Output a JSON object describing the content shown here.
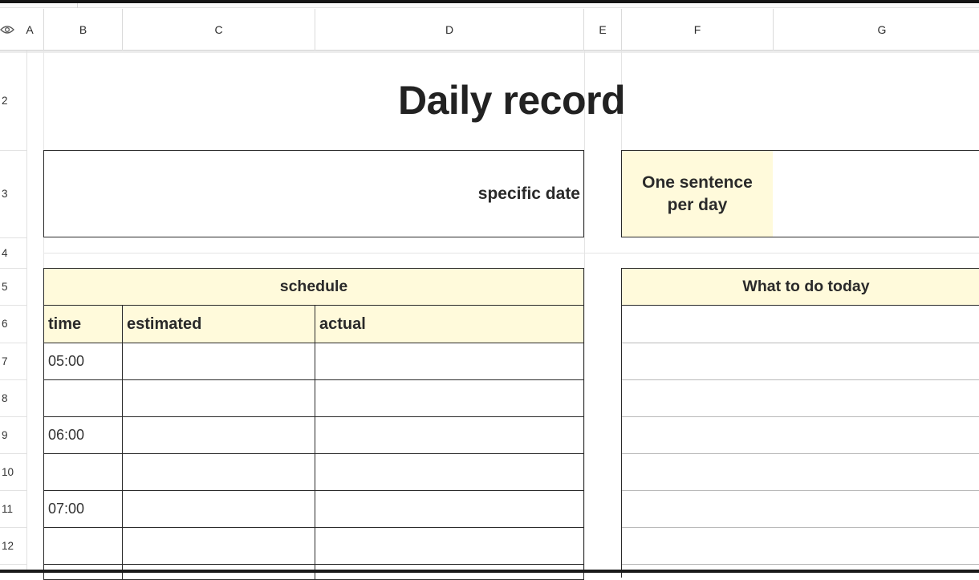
{
  "columns": [
    "A",
    "B",
    "C",
    "D",
    "E",
    "F",
    "G"
  ],
  "rows": [
    "2",
    "3",
    "4",
    "5",
    "6",
    "7",
    "8",
    "9",
    "10",
    "11",
    "12"
  ],
  "title": "Daily record",
  "date_label": "specific date",
  "sentence_label_line1": "One sentence",
  "sentence_label_line2": "per day",
  "schedule": {
    "header": "schedule",
    "col_time": "time",
    "col_estimated": "estimated",
    "col_actual": "actual",
    "times": [
      "05:00",
      "",
      "06:00",
      "",
      "07:00",
      ""
    ]
  },
  "todo_header": "What to do today",
  "colors": {
    "header_fill": "#fffadb",
    "border": "#2a2a2a",
    "grid": "#e4e4e4"
  }
}
